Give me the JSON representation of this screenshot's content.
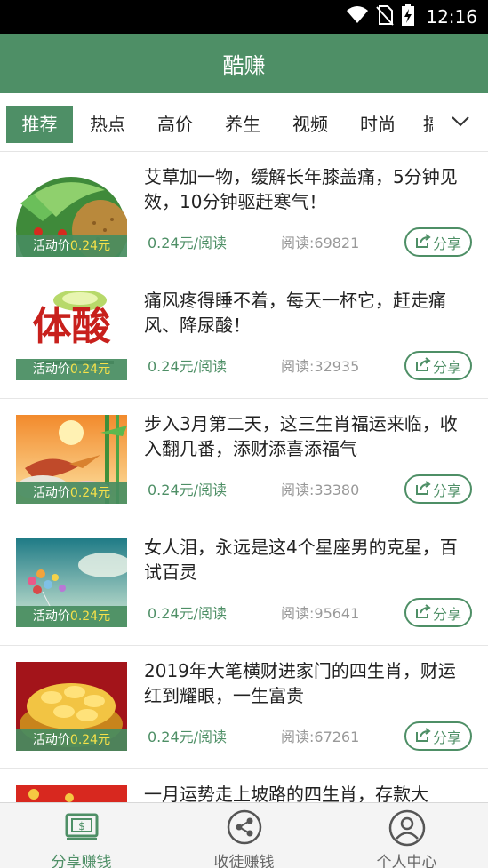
{
  "status_bar": {
    "time": "12:16"
  },
  "app_bar": {
    "title": "酷赚"
  },
  "tabs": [
    {
      "label": "推荐",
      "active": true
    },
    {
      "label": "热点"
    },
    {
      "label": "高价"
    },
    {
      "label": "养生"
    },
    {
      "label": "视频"
    },
    {
      "label": "时尚"
    },
    {
      "label": "搞"
    }
  ],
  "articles": [
    {
      "title": "艾草加一物，缓解长年膝盖痛，5分钟见效，10分钟驱赶寒气！",
      "price_label": "活动价",
      "price": "0.24元",
      "rate": "0.24元/阅读",
      "reads": "阅读:69821",
      "share": "分享",
      "image": "herb-field"
    },
    {
      "title": "痛风疼得睡不着，每天一杯它，赶走痛风、降尿酸！",
      "price_label": "活动价",
      "price": "0.24元",
      "rate": "0.24元/阅读",
      "reads": "阅读:32935",
      "share": "分享",
      "image": "uric-acid-text",
      "image_text": "体酸"
    },
    {
      "title": "步入3月第二天，这三生肖福运来临，收入翻几番，添财添喜添福气",
      "price_label": "活动价",
      "price": "0.24元",
      "rate": "0.24元/阅读",
      "reads": "阅读:33380",
      "share": "分享",
      "image": "pheasant-painting"
    },
    {
      "title": "女人泪，永远是这4个星座男的克星，百试百灵",
      "price_label": "活动价",
      "price": "0.24元",
      "rate": "0.24元/阅读",
      "reads": "阅读:95641",
      "share": "分享",
      "image": "balloons-sky"
    },
    {
      "title": "2019年大笔横财进家门的四生肖，财运红到耀眼，一生富贵",
      "price_label": "活动价",
      "price": "0.24元",
      "rate": "0.24元/阅读",
      "reads": "阅读:67261",
      "share": "分享",
      "image": "gold-ingots"
    },
    {
      "title": "一月运势走上坡路的四生肖，存款大",
      "image": "red-festive"
    }
  ],
  "bottom_nav": [
    {
      "label": "分享赚钱",
      "icon": "money-icon",
      "active": true
    },
    {
      "label": "收徒赚钱",
      "icon": "share-circle-icon"
    },
    {
      "label": "个人中心",
      "icon": "user-icon"
    }
  ],
  "colors": {
    "brand": "#4e8f66",
    "price_highlight": "#f6e14a",
    "status_bar": "#000000"
  }
}
